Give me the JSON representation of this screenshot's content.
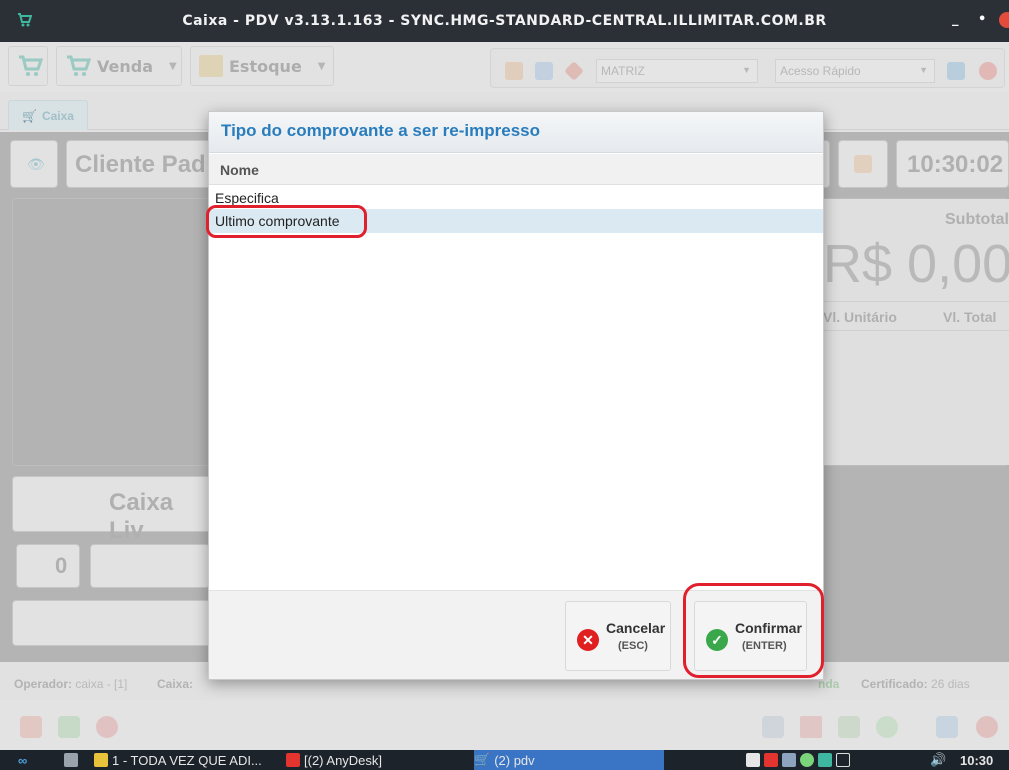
{
  "window": {
    "title": "Caixa - PDV v3.13.1.163 - SYNC.HMG-STANDARD-CENTRAL.ILLIMITAR.COM.BR",
    "minimize": "_",
    "restore": "•",
    "close": "✕"
  },
  "toolbar": {
    "venda_label": "Venda",
    "estoque_label": "Estoque",
    "filial_value": "MATRIZ",
    "acesso_placeholder": "Acesso Rápido"
  },
  "tabs": {
    "caixa": "Caixa"
  },
  "workspace": {
    "cliente": "Cliente Pad",
    "clock": "10:30:02",
    "subtotal_label": "Subtotal",
    "total_value": "R$ 0,00",
    "col_unitario": "Vl. Unitário",
    "col_total": "Vl. Total",
    "caixa_status": "Caixa Liv",
    "qty": "0"
  },
  "status": {
    "operador_label": "Operador:",
    "operador_value": "caixa - [1]",
    "caixa_label": "Caixa:",
    "certificado_label": "Certificado:",
    "certificado_value": "26 dias",
    "venda_frag": "nda"
  },
  "dialog": {
    "title": "Tipo do comprovante a ser re-impresso",
    "column_header": "Nome",
    "rows": [
      "Especifica",
      "Ultimo comprovante"
    ],
    "selected_index": 1,
    "cancel_label": "Cancelar",
    "cancel_shortcut": "(ESC)",
    "confirm_label": "Confirmar",
    "confirm_shortcut": "(ENTER)"
  },
  "taskbar": {
    "item1": "1 - TODA VEZ QUE ADI...",
    "item2": "[(2) AnyDesk]",
    "item3": "(2) pdv",
    "clock": "10:30"
  },
  "colors": {
    "accent": "#2a7dbd",
    "highlight": "#e0202c",
    "selection": "#dbe9f2",
    "confirm_green": "#3aa84a",
    "cancel_red": "#e02020"
  }
}
